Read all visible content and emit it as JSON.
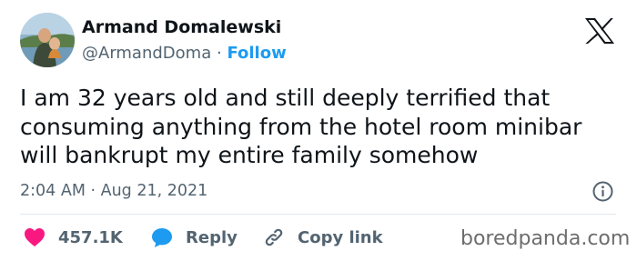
{
  "author": {
    "display_name": "Armand Domalewski",
    "handle": "@ArmandDoma",
    "separator": "·",
    "follow_label": "Follow"
  },
  "tweet": {
    "lines": [
      "I am 32 years old and still deeply terrified that",
      "consuming anything from the hotel room minibar",
      "will bankrupt my entire family somehow"
    ],
    "timestamp": "2:04 AM · Aug 21, 2021"
  },
  "actions": {
    "like_count": "457.1K",
    "reply_label": "Reply",
    "copy_link_label": "Copy link"
  },
  "icons": {
    "platform": "x-logo-icon",
    "info": "info-icon",
    "like": "heart-icon",
    "reply": "speech-bubble-icon",
    "copy": "link-icon"
  },
  "colors": {
    "text": "#0f1419",
    "secondary": "#536471",
    "accent": "#1d9bf0",
    "like": "#f91880"
  },
  "watermark": "boredpanda.com"
}
